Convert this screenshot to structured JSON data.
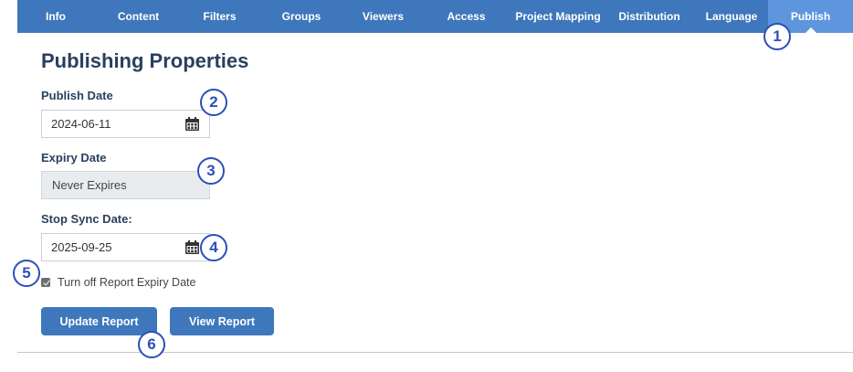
{
  "nav": {
    "tabs": [
      {
        "label": "Info"
      },
      {
        "label": "Content"
      },
      {
        "label": "Filters"
      },
      {
        "label": "Groups"
      },
      {
        "label": "Viewers"
      },
      {
        "label": "Access"
      },
      {
        "label": "Project Mapping"
      },
      {
        "label": "Distribution"
      },
      {
        "label": "Language"
      },
      {
        "label": "Publish"
      }
    ],
    "active_tab": "Publish"
  },
  "page": {
    "title": "Publishing Properties"
  },
  "form": {
    "publish_date": {
      "label": "Publish Date",
      "value": "2024-06-11",
      "icon": "calendar-icon"
    },
    "expiry_date": {
      "label": "Expiry Date",
      "value": "Never Expires"
    },
    "stop_sync_date": {
      "label": "Stop Sync Date:",
      "value": "2025-09-25",
      "icon": "calendar-icon"
    },
    "turn_off_expiry": {
      "label": "Turn off Report Expiry Date",
      "checked": true
    }
  },
  "buttons": {
    "update": "Update Report",
    "view": "View Report"
  },
  "callouts": [
    "1",
    "2",
    "3",
    "4",
    "5",
    "6"
  ],
  "colors": {
    "nav_bg": "#3f77bc",
    "nav_active": "#5d96dd",
    "title": "#2a3f5f",
    "callout": "#2d4fb8"
  }
}
